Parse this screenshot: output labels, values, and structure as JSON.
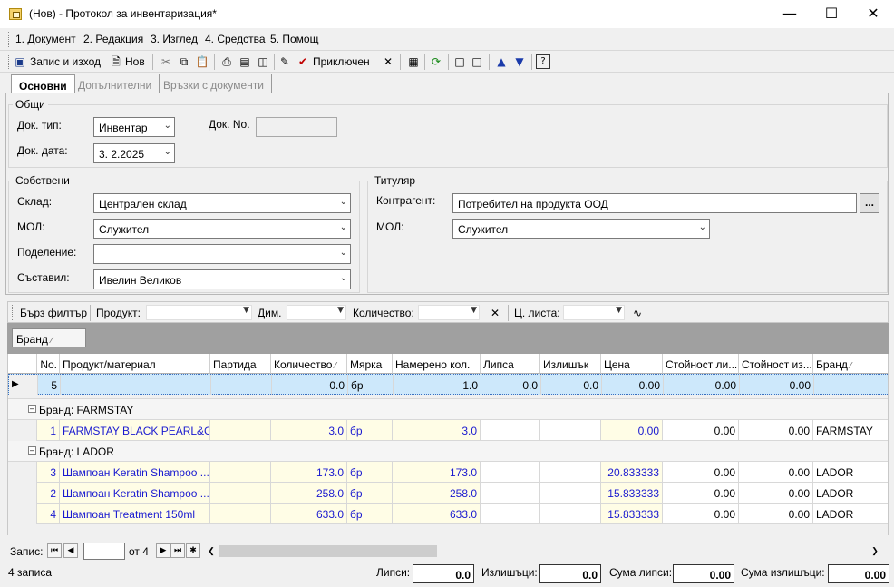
{
  "window": {
    "title": "(Нов) - Протокол за инвентаризация*"
  },
  "menu": [
    "1. Документ",
    "2. Редакция",
    "3. Изглед",
    "4. Средства",
    "5. Помощ"
  ],
  "toolbar": {
    "save_exit": "Запис и изход",
    "new": "Нов",
    "conclude": "Приключен"
  },
  "tabs": [
    "Основни",
    "Допълнителни",
    "Връзки с документи"
  ],
  "general": {
    "title": "Общи",
    "doc_type_label": "Док. тип:",
    "doc_type_value": "Инвентар",
    "doc_no_label": "Док. No.",
    "doc_no_value": "",
    "doc_date_label": "Док. дата:",
    "doc_date_value": "3.  2.2025"
  },
  "own": {
    "title": "Собствени",
    "warehouse_label": "Склад:",
    "warehouse_value": "Централен склад",
    "mol_label": "МОЛ:",
    "mol_value": "Служител",
    "division_label": "Поделение:",
    "division_value": "",
    "compiled_label": "Съставил:",
    "compiled_value": "Ивелин Великов"
  },
  "holder": {
    "title": "Титуляр",
    "contractor_label": "Контрагент:",
    "contractor_value": "Потребител на продукта ООД",
    "mol_label": "МОЛ:",
    "mol_value": "Служител",
    "ellipsis": "..."
  },
  "filter": {
    "quick": "Бърз филтър",
    "product": "Продукт:",
    "dim": "Дим.",
    "qty": "Количество:",
    "price_list": "Ц. листа:"
  },
  "group_chip": "Бранд",
  "columns": [
    "No.",
    "Продукт/материал",
    "Партида",
    "Количество",
    "Мярка",
    "Намерено кол.",
    "Липса",
    "Излишък",
    "Цена",
    "Стойност ли...",
    "Стойност из...",
    "Бранд"
  ],
  "summary_row": {
    "no": "5",
    "qty": "0.0",
    "unit": "бр",
    "found": "1.0",
    "missing": "0.0",
    "surplus": "0.0",
    "price": "0.00",
    "val_missing": "0.00",
    "val_surplus": "0.00"
  },
  "groups": [
    {
      "label": "Бранд: FARMSTAY",
      "rows": [
        {
          "no": "1",
          "product": "FARMSTAY BLACK PEARL&G...",
          "qty": "3.0",
          "unit": "бр",
          "found": "3.0",
          "price": "0.00",
          "val_missing": "0.00",
          "val_surplus": "0.00",
          "brand": "FARMSTAY"
        }
      ]
    },
    {
      "label": "Бранд: LADOR",
      "rows": [
        {
          "no": "3",
          "product": "Шампоан Keratin Shampoo ...",
          "qty": "173.0",
          "unit": "бр",
          "found": "173.0",
          "price": "20.833333",
          "val_missing": "0.00",
          "val_surplus": "0.00",
          "brand": "LADOR"
        },
        {
          "no": "2",
          "product": "Шампоан Keratin Shampoo ...",
          "qty": "258.0",
          "unit": "бр",
          "found": "258.0",
          "price": "15.833333",
          "val_missing": "0.00",
          "val_surplus": "0.00",
          "brand": "LADOR"
        },
        {
          "no": "4",
          "product": "Шампоан Treatment 150ml",
          "qty": "633.0",
          "unit": "бр",
          "found": "633.0",
          "price": "15.833333",
          "val_missing": "0.00",
          "val_surplus": "0.00",
          "brand": "LADOR"
        }
      ]
    }
  ],
  "navigator": {
    "label": "Запис:",
    "current": "",
    "of": "от 4"
  },
  "status": {
    "records": "4 записа",
    "missing_label": "Липси:",
    "missing_value": "0.0",
    "surplus_label": "Излишъци:",
    "surplus_value": "0.0",
    "sum_missing_label": "Сума липси:",
    "sum_missing_value": "0.00",
    "sum_surplus_label": "Сума излишъци:",
    "sum_surplus_value": "0.00"
  }
}
